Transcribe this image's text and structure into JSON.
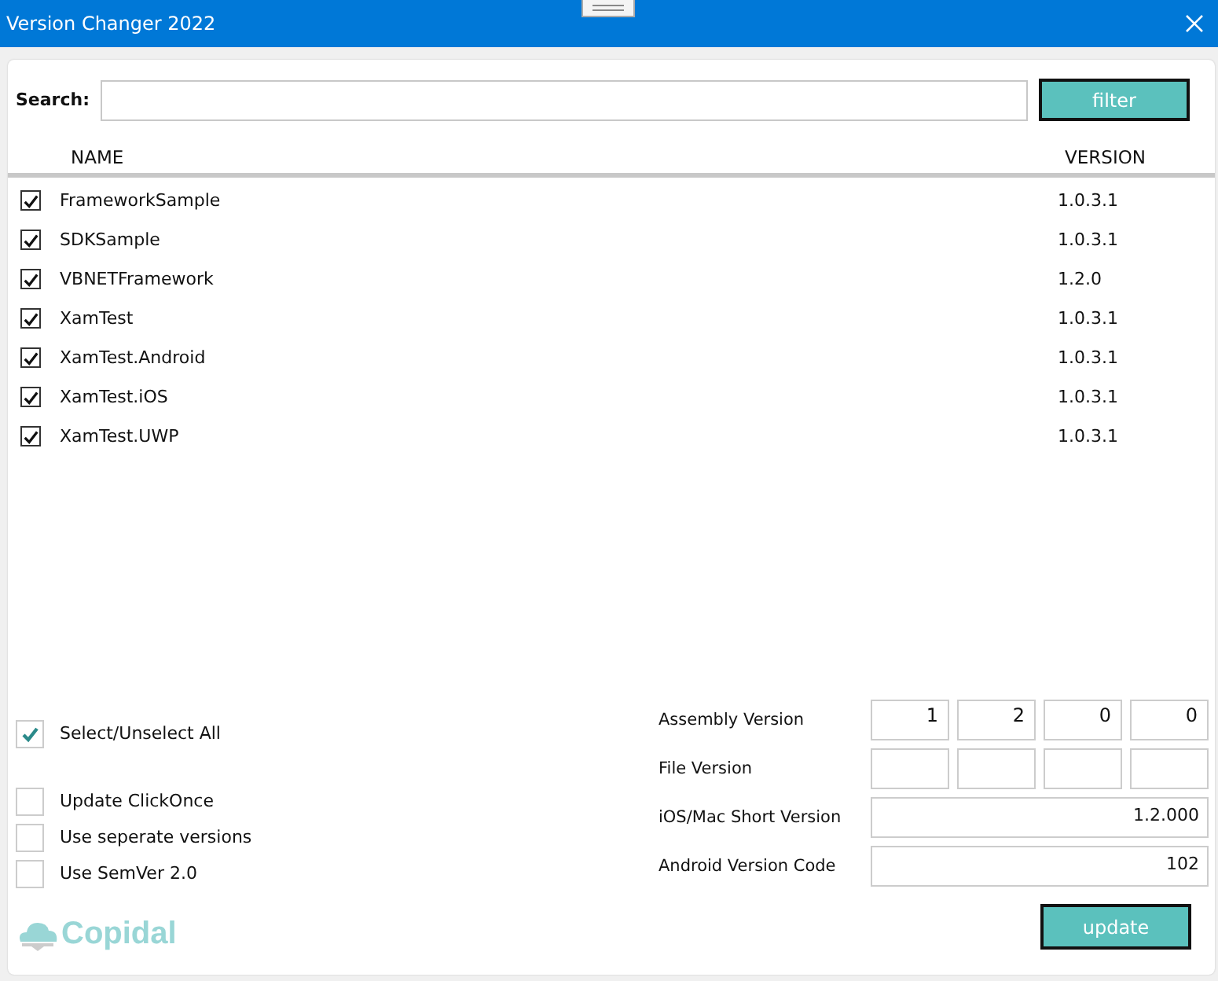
{
  "window": {
    "title": "Version Changer 2022"
  },
  "search": {
    "label": "Search:",
    "button": "filter"
  },
  "table": {
    "columns": [
      "NAME",
      "VERSION"
    ],
    "rows": [
      {
        "name": "FrameworkSample",
        "version": "1.0.3.1",
        "checked": true
      },
      {
        "name": "SDKSample",
        "version": "1.0.3.1",
        "checked": true
      },
      {
        "name": "VBNETFramework",
        "version": "1.2.0",
        "checked": true
      },
      {
        "name": "XamTest",
        "version": "1.0.3.1",
        "checked": true
      },
      {
        "name": "XamTest.Android",
        "version": "1.0.3.1",
        "checked": true
      },
      {
        "name": "XamTest.iOS",
        "version": "1.0.3.1",
        "checked": true
      },
      {
        "name": "XamTest.UWP",
        "version": "1.0.3.1",
        "checked": true
      }
    ]
  },
  "select_all": {
    "label": "Select/Unselect All",
    "checked": true
  },
  "options": [
    {
      "label": "Update ClickOnce",
      "checked": false
    },
    {
      "label": "Use seperate versions",
      "checked": false
    },
    {
      "label": "Use SemVer 2.0",
      "checked": false
    }
  ],
  "logo": {
    "text": "Copidal"
  },
  "versions": [
    {
      "label": "Assembly Version",
      "kind": "parts",
      "values": [
        "1",
        "2",
        "0",
        "0"
      ]
    },
    {
      "label": "File Version",
      "kind": "parts"
    },
    {
      "label": "iOS/Mac Short Version",
      "kind": "single",
      "value": "1.2.000"
    },
    {
      "label": "Android Version Code",
      "kind": "single",
      "value": "102"
    }
  ],
  "update_button": "update"
}
